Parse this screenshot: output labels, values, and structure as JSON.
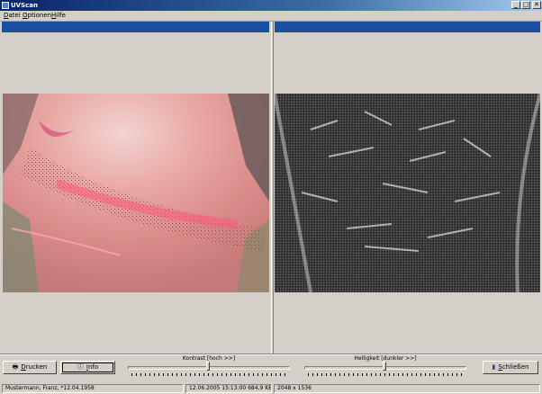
{
  "window": {
    "title": "UVScan",
    "minimize": "_",
    "maximize": "□",
    "close": "✕"
  },
  "menu": [
    "Datei",
    "Optionen",
    "Hilfe"
  ],
  "panels": {
    "left_header": "",
    "right_header": ""
  },
  "controls": {
    "print_label": "Drucken",
    "info_label": "Info",
    "close_label": "Schließen",
    "contrast_label": "Kontrast [hoch >>]",
    "contrast_value": 0.5,
    "brightness_label": "Helligkeit [dunkler >>]",
    "brightness_value": 0.5
  },
  "status": {
    "patient": "Mustermann, Franz, *12.04.1958",
    "file_info": "12.06.2005 15:13:00  684,9 KB",
    "resolution": "2048 x 1536"
  },
  "colors": {
    "panel_header": "#1c4fa0",
    "title_active": "#0a246a"
  }
}
